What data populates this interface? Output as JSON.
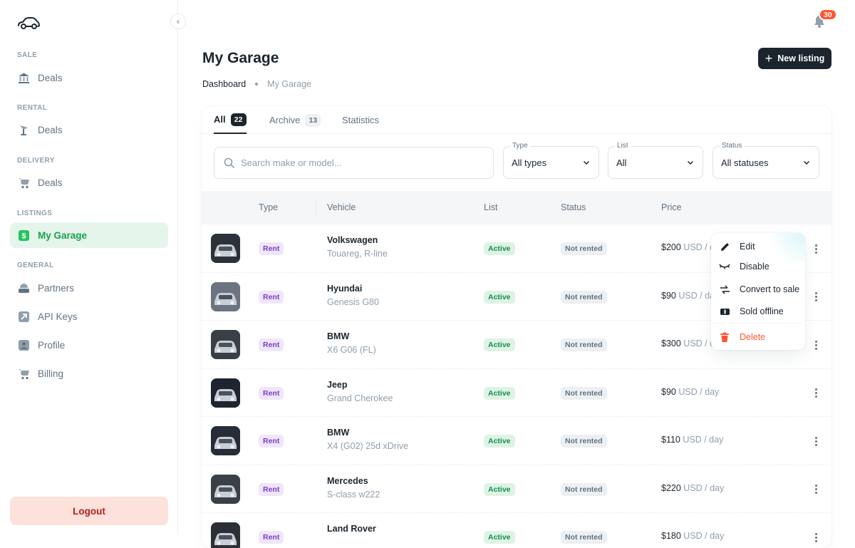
{
  "sidebar": {
    "sections": [
      {
        "title": "SALE",
        "items": [
          {
            "label": "Deals",
            "icon": "bank-icon"
          }
        ]
      },
      {
        "title": "RENTAL",
        "items": [
          {
            "label": "Deals",
            "icon": "key-icon"
          }
        ]
      },
      {
        "title": "DELIVERY",
        "items": [
          {
            "label": "Deals",
            "icon": "cart-icon"
          }
        ]
      },
      {
        "title": "LISTINGS",
        "items": [
          {
            "label": "My Garage",
            "icon": "dollar-tag-icon",
            "active": true
          }
        ]
      },
      {
        "title": "GENERAL",
        "items": [
          {
            "label": "Partners",
            "icon": "handshake-icon"
          },
          {
            "label": "API Keys",
            "icon": "arrow-up-right-icon"
          },
          {
            "label": "Profile",
            "icon": "user-icon"
          },
          {
            "label": "Billing",
            "icon": "cart-icon"
          }
        ]
      }
    ],
    "logout_label": "Logout"
  },
  "header": {
    "notifications_count": "30",
    "title": "My Garage",
    "breadcrumb": [
      "Dashboard",
      "My Garage"
    ],
    "new_listing_label": "New listing"
  },
  "tabs": [
    {
      "label": "All",
      "count": "22",
      "active": true
    },
    {
      "label": "Archive",
      "count": "13"
    },
    {
      "label": "Statistics",
      "count": ""
    }
  ],
  "filters": {
    "search_placeholder": "Search make or model...",
    "type": {
      "label": "Type",
      "value": "All types"
    },
    "list": {
      "label": "List",
      "value": "All"
    },
    "status": {
      "label": "Status",
      "value": "All statuses"
    }
  },
  "table": {
    "columns": [
      "Type",
      "Vehicle",
      "List",
      "Status",
      "Price"
    ],
    "rows": [
      {
        "type": "Rent",
        "make": "Volkswagen",
        "model": "Touareg, R-line",
        "list": "Active",
        "status": "Not rented",
        "price": "$200",
        "unit": "USD / day"
      },
      {
        "type": "Rent",
        "make": "Hyundai",
        "model": "Genesis G80",
        "list": "Active",
        "status": "Not rented",
        "price": "$90",
        "unit": "USD / day"
      },
      {
        "type": "Rent",
        "make": "BMW",
        "model": "X6 G06 (FL)",
        "list": "Active",
        "status": "Not rented",
        "price": "$300",
        "unit": "USD / day"
      },
      {
        "type": "Rent",
        "make": "Jeep",
        "model": "Grand Cherokee",
        "list": "Active",
        "status": "Not rented",
        "price": "$90",
        "unit": "USD / day"
      },
      {
        "type": "Rent",
        "make": "BMW",
        "model": "X4 (G02) 25d xDrive",
        "list": "Active",
        "status": "Not rented",
        "price": "$110",
        "unit": "USD / day"
      },
      {
        "type": "Rent",
        "make": "Mercedes",
        "model": "S-class w222",
        "list": "Active",
        "status": "Not rented",
        "price": "$220",
        "unit": "USD / day"
      },
      {
        "type": "Rent",
        "make": "Land Rover",
        "model": "",
        "list": "Active",
        "status": "Not rented",
        "price": "$180",
        "unit": "USD / day"
      }
    ]
  },
  "row_menu": {
    "items": [
      {
        "label": "Edit",
        "icon": "pencil-icon"
      },
      {
        "label": "Disable",
        "icon": "eye-closed-icon"
      },
      {
        "label": "Convert to sale",
        "icon": "swap-icon"
      },
      {
        "label": "Sold offline",
        "icon": "ticket-icon"
      },
      {
        "label": "Delete",
        "icon": "trash-icon"
      }
    ]
  },
  "colors": {
    "accent": "#16a34a",
    "danger": "#ff5630",
    "dark": "#1c252e"
  }
}
